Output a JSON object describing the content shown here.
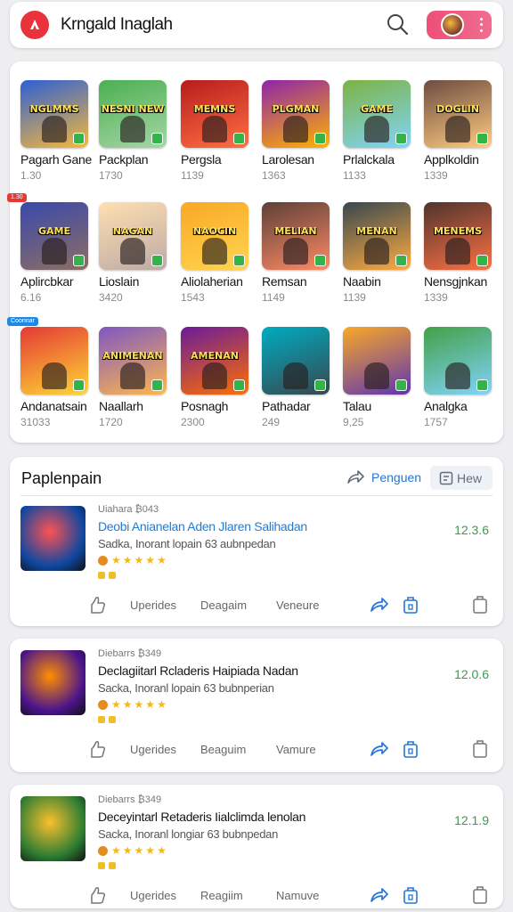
{
  "header": {
    "title": "Krngald Inaglah",
    "icons": {
      "logo": "app-logo",
      "search": "search-icon",
      "menu": "more-vertical-icon"
    }
  },
  "games": [
    {
      "name": "Pagarh Gane",
      "count": "1.30",
      "caption": "NGLMMS",
      "colors": [
        "#2e5fd6",
        "#f5b93a"
      ]
    },
    {
      "name": "Packplan",
      "count": "1730",
      "caption": "NESNI NEW",
      "colors": [
        "#4caf50",
        "#a5d6a7"
      ]
    },
    {
      "name": "Pergsla",
      "count": "1139",
      "caption": "MEMNS",
      "colors": [
        "#b71c1c",
        "#ff7043"
      ]
    },
    {
      "name": "Larolesan",
      "count": "1363",
      "caption": "PLGMAN",
      "colors": [
        "#8e24aa",
        "#ffb300"
      ]
    },
    {
      "name": "Prlalckala",
      "count": "1133",
      "caption": "GAME",
      "colors": [
        "#7cb342",
        "#81d4fa"
      ]
    },
    {
      "name": "Applkoldin",
      "count": "1339",
      "caption": "DOGLIN",
      "colors": [
        "#6d4c41",
        "#ffcc80"
      ]
    },
    {
      "name": "Aplircbkar",
      "count": "6.16",
      "caption": "GAME",
      "colors": [
        "#3949ab",
        "#8d6e63"
      ]
    },
    {
      "name": "Lioslain",
      "count": "3420",
      "caption": "NAGAN",
      "colors": [
        "#ffe0b2",
        "#bcaaa4"
      ]
    },
    {
      "name": "Aliolaherian",
      "count": "1543",
      "caption": "NAOCIN",
      "colors": [
        "#f9a825",
        "#ffd54f"
      ]
    },
    {
      "name": "Remsan",
      "count": "1149",
      "caption": "MELIAN",
      "colors": [
        "#5d4037",
        "#ff8a65"
      ]
    },
    {
      "name": "Naabin",
      "count": "1139",
      "caption": "MENAN",
      "colors": [
        "#37474f",
        "#ffab40"
      ]
    },
    {
      "name": "Nensgjnkan",
      "count": "1339",
      "caption": "MENEMS",
      "colors": [
        "#4e342e",
        "#ff7043"
      ]
    },
    {
      "name": "Andanatsain",
      "count": "31033",
      "caption": "",
      "colors": [
        "#e53935",
        "#fdd835"
      ]
    },
    {
      "name": "Naallarh",
      "count": "1720",
      "caption": "ANIMENAN",
      "colors": [
        "#7e57c2",
        "#ffb74d"
      ]
    },
    {
      "name": "Posnagh",
      "count": "2300",
      "caption": "AMENAN",
      "colors": [
        "#6a1b9a",
        "#ff6f00"
      ]
    },
    {
      "name": "Pathadar",
      "count": "249",
      "caption": "",
      "colors": [
        "#00acc1",
        "#37474f"
      ]
    },
    {
      "name": "Talau",
      "count": "9,25",
      "caption": "",
      "colors": [
        "#f9a825",
        "#5e35b1"
      ]
    },
    {
      "name": "Analgka",
      "count": "1757",
      "caption": "",
      "colors": [
        "#43a047",
        "#81d4fa"
      ]
    }
  ],
  "side_tags": [
    {
      "text": "1.30",
      "color": "#e53935"
    },
    {
      "text": "Coonnar",
      "color": "#1e88e5"
    }
  ],
  "section": {
    "title": "Paplenpain",
    "share_label": "Penguen",
    "view_label": "Hew"
  },
  "entries": [
    {
      "meta": "Uiahara ₿043",
      "title": "Deobi Anianelan Aden Jlaren Salihadan",
      "title_color": "#1f7bd8",
      "desc": "Sadka, Inorant lopain 63 aubnpedan",
      "version": "12.3.6",
      "actions": [
        "Uperides",
        "Deagaim",
        "Veneure"
      ],
      "colors": [
        "#0d47a1",
        "#ff5252"
      ]
    },
    {
      "meta": "Diebarrs ₿349",
      "title": "Declagiitarl Rcladeris Haipiada Nadan",
      "title_color": "#151515",
      "desc": "Sacka, Inoranl lopain 63 bubnperian",
      "version": "12.0.6",
      "actions": [
        "Ugerides",
        "Beaguim",
        "Vamure"
      ],
      "colors": [
        "#4a148c",
        "#ff8f00"
      ]
    },
    {
      "meta": "Diebarrs ₿349",
      "title": "Deceyintarl Retaderis Iialclimda lenolan",
      "title_color": "#151515",
      "desc": "Sacka, Inoranl longiar 63 bubnpedan",
      "version": "12.1.9",
      "actions": [
        "Ugerides",
        "Reagiim",
        "Namuve"
      ],
      "colors": [
        "#2e7d32",
        "#fbc02d"
      ]
    }
  ],
  "colors": {
    "accent": "#2376d6",
    "brand": "#e8323c",
    "version": "#3a9c4a",
    "star": "#f4b81d"
  }
}
